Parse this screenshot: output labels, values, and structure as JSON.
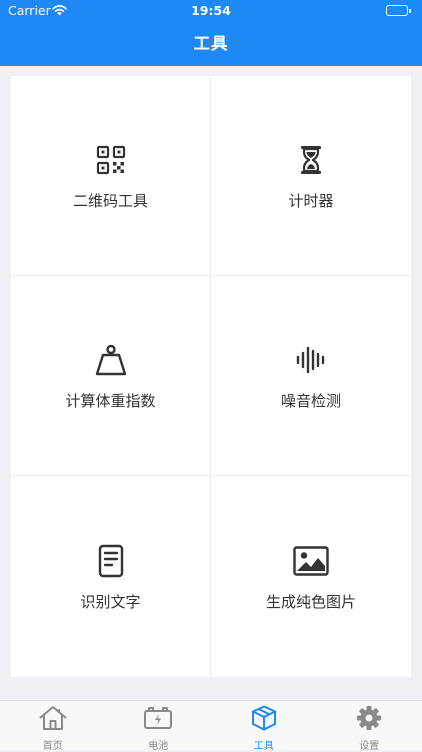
{
  "status_bar": {
    "carrier": "Carrier",
    "time": "19:54"
  },
  "header": {
    "title": "工具",
    "color": "#1E88F5"
  },
  "tools": [
    {
      "label": "二维码工具",
      "icon": "qr-code-icon"
    },
    {
      "label": "计时器",
      "icon": "hourglass-icon"
    },
    {
      "label": "计算体重指数",
      "icon": "weight-icon"
    },
    {
      "label": "噪音检测",
      "icon": "sound-wave-icon"
    },
    {
      "label": "识别文字",
      "icon": "document-icon"
    },
    {
      "label": "生成纯色图片",
      "icon": "image-icon"
    }
  ],
  "tabbar": {
    "items": [
      {
        "label": "首页",
        "icon": "home-icon",
        "active": false
      },
      {
        "label": "电池",
        "icon": "battery-icon",
        "active": false
      },
      {
        "label": "工具",
        "icon": "box-icon",
        "active": true
      },
      {
        "label": "设置",
        "icon": "gear-icon",
        "active": false
      }
    ],
    "active_color": "#1E88F5",
    "inactive_color": "#8A8A8A"
  }
}
